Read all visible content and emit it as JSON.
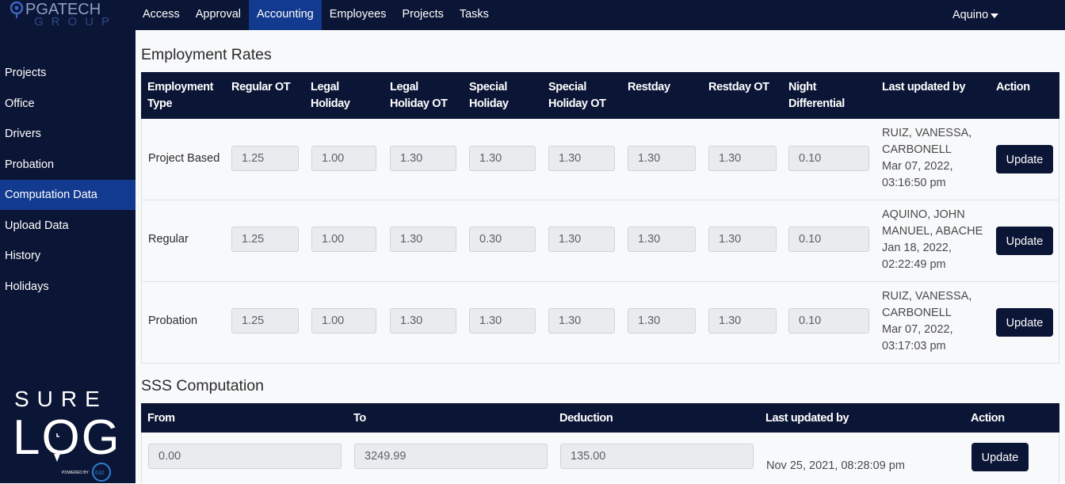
{
  "brand": {
    "name": "PGATECH",
    "sub": "GROUP"
  },
  "nav": {
    "items": [
      {
        "label": "Access"
      },
      {
        "label": "Approval"
      },
      {
        "label": "Accounting",
        "active": true
      },
      {
        "label": "Employees"
      },
      {
        "label": "Projects"
      },
      {
        "label": "Tasks"
      }
    ],
    "user": "Aquino"
  },
  "sidebar": {
    "items": [
      {
        "label": "Projects"
      },
      {
        "label": "Office"
      },
      {
        "label": "Drivers"
      },
      {
        "label": "Probation"
      },
      {
        "label": "Computation Data",
        "active": true
      },
      {
        "label": "Upload Data"
      },
      {
        "label": "History"
      },
      {
        "label": "Holidays"
      }
    ],
    "logo": {
      "line1": "SURE",
      "line2": "LOG",
      "tagline": "POWERED BY",
      "badge": "632"
    }
  },
  "employment": {
    "title": "Employment Rates",
    "headers": [
      "Employment Type",
      "Regular OT",
      "Legal Holiday",
      "Legal Holiday OT",
      "Special Holiday",
      "Special Holiday OT",
      "Restday",
      "Restday OT",
      "Night Differential",
      "Last updated by",
      "Action"
    ],
    "header_lines": [
      [
        "Employment",
        "Type"
      ],
      [
        "Regular OT"
      ],
      [
        "Legal",
        "Holiday"
      ],
      [
        "Legal",
        "Holiday OT"
      ],
      [
        "Special",
        "Holiday"
      ],
      [
        "Special",
        "Holiday OT"
      ],
      [
        "Restday"
      ],
      [
        "Restday OT"
      ],
      [
        "Night",
        "Differential"
      ],
      [
        "Last updated by"
      ],
      [
        "Action"
      ]
    ],
    "rows": [
      {
        "type": "Project Based",
        "values": [
          "1.25",
          "1.00",
          "1.30",
          "1.30",
          "1.30",
          "1.30",
          "1.30",
          "0.10"
        ],
        "updated_lines": [
          "RUIZ, VANESSA,",
          "CARBONELL",
          "Mar 07, 2022,",
          "03:16:50 pm"
        ],
        "action": "Update"
      },
      {
        "type": "Regular",
        "values": [
          "1.25",
          "1.00",
          "1.30",
          "0.30",
          "1.30",
          "1.30",
          "1.30",
          "0.10"
        ],
        "updated_lines": [
          "AQUINO, JOHN",
          "MANUEL, ABACHE",
          "Jan 18, 2022,",
          "02:22:49 pm"
        ],
        "action": "Update"
      },
      {
        "type": "Probation",
        "values": [
          "1.25",
          "1.00",
          "1.30",
          "1.30",
          "1.30",
          "1.30",
          "1.30",
          "0.10"
        ],
        "updated_lines": [
          "RUIZ, VANESSA,",
          "CARBONELL",
          "Mar 07, 2022,",
          "03:17:03 pm"
        ],
        "action": "Update"
      }
    ]
  },
  "sss": {
    "title": "SSS Computation",
    "headers": [
      "From",
      "To",
      "Deduction",
      "Last updated by",
      "Action"
    ],
    "rows": [
      {
        "from": "0.00",
        "to": "3249.99",
        "deduction": "135.00",
        "updated": "Nov 25, 2021, 08:28:09 pm",
        "action": "Update"
      }
    ]
  },
  "colors": {
    "navy": "#0b1535",
    "active_blue": "#123a8f",
    "input_bg": "#e9ecef"
  }
}
